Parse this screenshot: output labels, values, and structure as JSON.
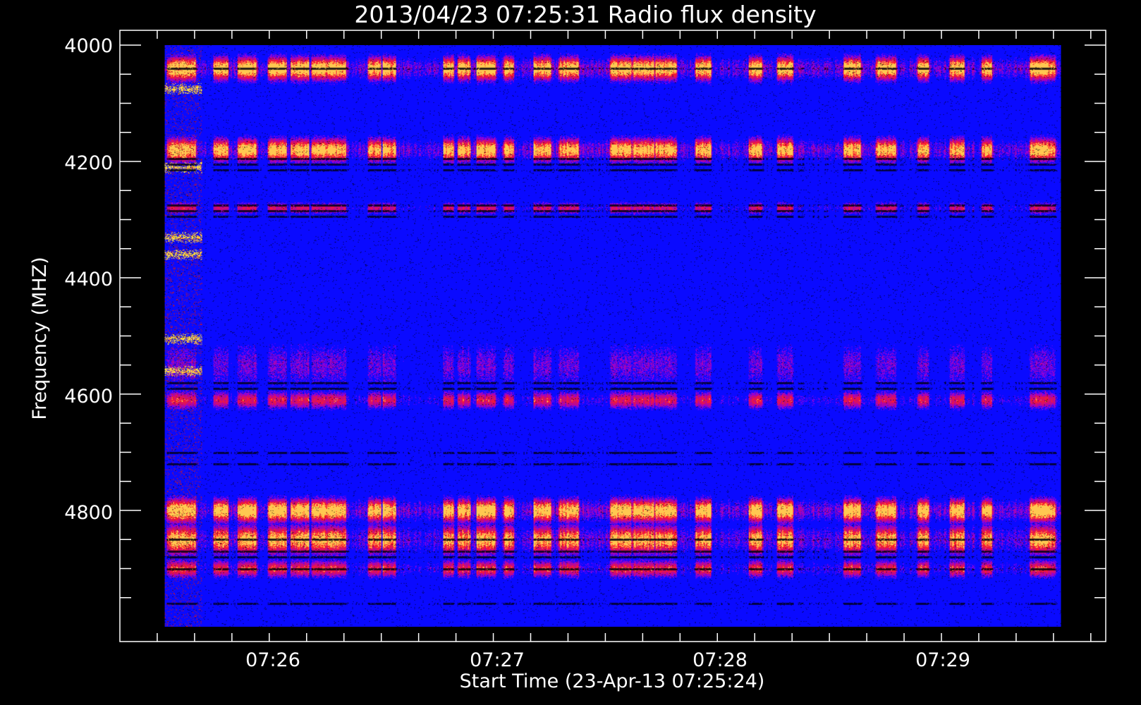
{
  "chart_data": {
    "type": "heatmap",
    "title": "2013/04/23 07:25:31 Radio flux density",
    "xlabel": "Start Time (23-Apr-13 07:25:24)",
    "ylabel": "Frequency (MHZ)",
    "x_tick_labels": [
      "07:26",
      "07:27",
      "07:28",
      "07:29"
    ],
    "y_tick_labels": [
      "4000",
      "4200",
      "4400",
      "4600",
      "4800"
    ],
    "x_tick_values_s": [
      36,
      96,
      156,
      216
    ],
    "x_range_s": [
      -40,
      224
    ],
    "x_data_range_s": [
      -28,
      212
    ],
    "y_range_mhz": [
      4000,
      5000
    ],
    "y_data_range_mhz": [
      4000,
      5000
    ],
    "colorscale": [
      "#000000",
      "#0000ff",
      "#c00000",
      "#ff2000",
      "#ffff80"
    ],
    "background_color": "#0000ff",
    "bright_time_columns_s": [
      -26,
      -24,
      -22,
      -13,
      -6,
      2,
      8,
      14,
      18,
      28,
      32,
      48,
      52,
      58,
      64,
      73,
      80,
      94,
      100,
      106,
      116,
      130,
      138,
      156,
      165,
      175,
      184,
      192,
      206,
      208
    ],
    "bright_freq_bands_mhz": [
      {
        "center": 4040,
        "width": 40,
        "intensity": 0.9
      },
      {
        "center": 4180,
        "width": 40,
        "intensity": 0.85
      },
      {
        "center": 4280,
        "width": 20,
        "intensity": 0.5
      },
      {
        "center": 4550,
        "width": 80,
        "intensity": 0.3
      },
      {
        "center": 4610,
        "width": 30,
        "intensity": 0.55
      },
      {
        "center": 4800,
        "width": 40,
        "intensity": 0.9
      },
      {
        "center": 4850,
        "width": 50,
        "intensity": 0.8
      },
      {
        "center": 4900,
        "width": 30,
        "intensity": 0.6
      }
    ],
    "dark_freq_lines_mhz": [
      4040,
      4195,
      4205,
      4215,
      4275,
      4285,
      4295,
      4580,
      4590,
      4700,
      4720,
      4850,
      4870,
      4880,
      4900,
      4960
    ],
    "early_burst_bands_mhz": [
      4075,
      4210,
      4330,
      4360,
      4505,
      4560
    ]
  }
}
